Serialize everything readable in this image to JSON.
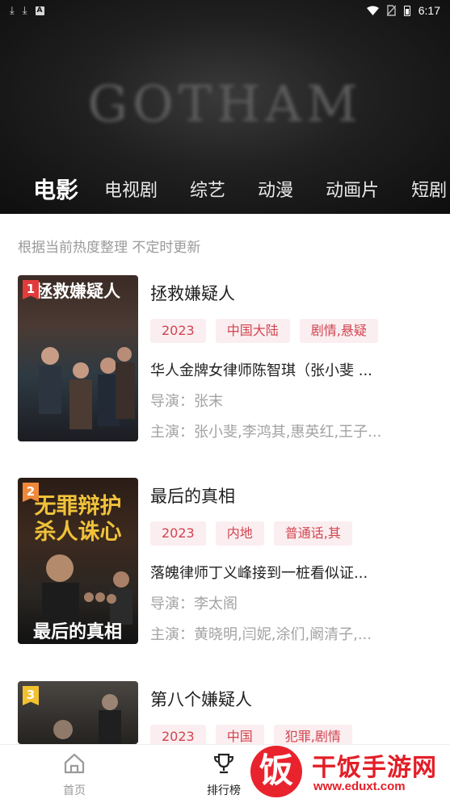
{
  "status_bar": {
    "time": "6:17",
    "left_icons": [
      "download-icon",
      "download-icon",
      "a-box-icon"
    ],
    "right_icons": [
      "wifi-icon",
      "no-sim-icon",
      "battery-icon"
    ]
  },
  "hero": {
    "background_text": "GOTHAM"
  },
  "tabs": [
    "电影",
    "电视剧",
    "综艺",
    "动漫",
    "动画片",
    "短剧"
  ],
  "active_tab": "电影",
  "subtitle": "根据当前热度整理 不定时更新",
  "items": [
    {
      "rank": "1",
      "title": "拯救嫌疑人",
      "poster_text": "拯救嫌疑人",
      "tags": [
        "2023",
        "中国大陆",
        "剧情,悬疑"
      ],
      "description": "华人金牌女律师陈智琪（张小斐 ...",
      "director": "导演：张末",
      "cast": "主演：张小斐,李鸿其,惠英红,王子..."
    },
    {
      "rank": "2",
      "title": "最后的真相",
      "poster_text": "无罪辩护 杀人诛心",
      "tags": [
        "2023",
        "内地",
        "普通话,其"
      ],
      "description": "落魄律师丁义峰接到一桩看似证...",
      "director": "导演：李太阁",
      "cast": "主演：黄晓明,闫妮,涂们,阚清子,..."
    },
    {
      "rank": "3",
      "title": "第八个嫌疑人",
      "poster_text": "",
      "tags": [
        "2023",
        "中国",
        "犯罪,剧情"
      ],
      "description": "",
      "director": "",
      "cast": ""
    }
  ],
  "bottom_nav": {
    "home_label": "首页",
    "rank_label": "排行榜"
  },
  "watermark": {
    "logo_char": "饭",
    "name": "干饭手游网",
    "url": "www.eduxt.com"
  },
  "colors": {
    "tag_bg": "#fbeef0",
    "tag_text": "#d2444f",
    "rank1": "#e23b3b",
    "rank2": "#f0883a",
    "rank3": "#f3c12f",
    "watermark_red": "#e31e27"
  }
}
